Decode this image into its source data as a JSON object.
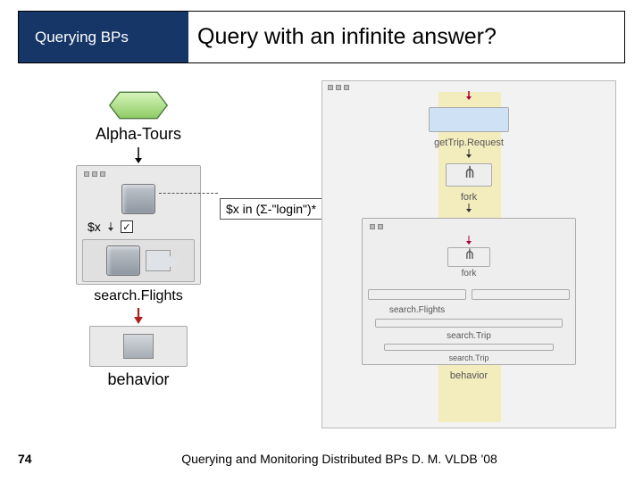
{
  "header": {
    "left": "Querying  BPs",
    "right": "Query with an infinite answer?"
  },
  "leftDiagram": {
    "topLabel": "Alpha-Tours",
    "constraint": "$x in (Σ-\"login\")*",
    "variable": "$x",
    "searchLabel": "search.Flights",
    "behavior": "behavior"
  },
  "rightDiagram": {
    "getTrip": "getTrip.Request",
    "fork1": "fork",
    "fork2": "fork",
    "searchFlights": "search.Flights",
    "searchTrip": "search.Trip",
    "searchTrip2": "search.Trip",
    "behavior": "behavior"
  },
  "footer": {
    "page": "74",
    "text": "Querying and Monitoring Distributed BPs D. M. VLDB '08"
  }
}
